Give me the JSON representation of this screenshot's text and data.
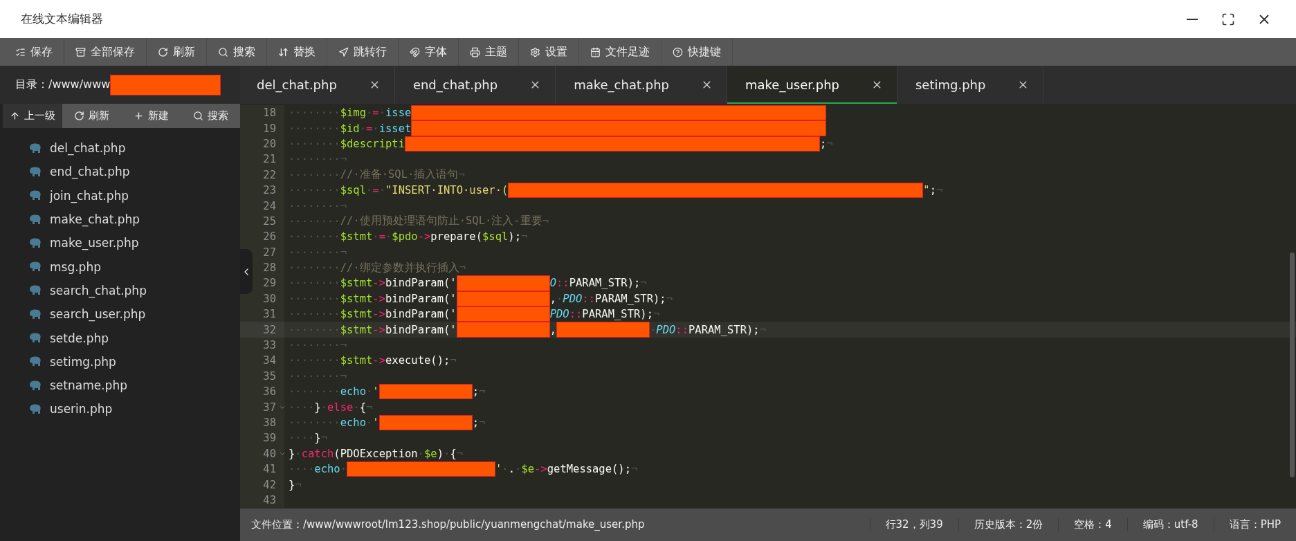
{
  "window": {
    "title": "在线文本编辑器"
  },
  "toolbar": [
    {
      "label": "保存"
    },
    {
      "label": "全部保存"
    },
    {
      "label": "刷新"
    },
    {
      "label": "搜索"
    },
    {
      "label": "替换"
    },
    {
      "label": "跳转行"
    },
    {
      "label": "字体"
    },
    {
      "label": "主题"
    },
    {
      "label": "设置"
    },
    {
      "label": "文件足迹"
    },
    {
      "label": "快捷键"
    }
  ],
  "sidebar": {
    "path_label": "目录：/www/www",
    "path_redacted": true,
    "buttons": [
      {
        "label": "上一级",
        "selected": true
      },
      {
        "label": "刷新",
        "selected": false
      },
      {
        "label": "新建",
        "selected": false
      },
      {
        "label": "搜索",
        "selected": false
      }
    ],
    "files": [
      "del_chat.php",
      "end_chat.php",
      "join_chat.php",
      "make_chat.php",
      "make_user.php",
      "msg.php",
      "search_chat.php",
      "search_user.php",
      "setde.php",
      "setimg.php",
      "setname.php",
      "userin.php"
    ]
  },
  "tabs": [
    {
      "label": "del_chat.php",
      "selected": false
    },
    {
      "label": "end_chat.php",
      "selected": false
    },
    {
      "label": "make_chat.php",
      "selected": false
    },
    {
      "label": "make_user.php",
      "selected": true
    },
    {
      "label": "setimg.php",
      "selected": false
    }
  ],
  "editor": {
    "lines": [
      {
        "number": "18",
        "current": false,
        "fold": false,
        "tokens": [
          {
            "kind": "ws",
            "text": "········"
          },
          {
            "kind": "var",
            "text": "$img"
          },
          {
            "kind": "ws",
            "text": "·"
          },
          {
            "kind": "op",
            "text": "="
          },
          {
            "kind": "ws",
            "text": "·"
          },
          {
            "kind": "func",
            "text": "isse"
          },
          {
            "kind": "redacted_long"
          }
        ]
      },
      {
        "number": "19",
        "current": false,
        "fold": false,
        "tokens": [
          {
            "kind": "ws",
            "text": "········"
          },
          {
            "kind": "var",
            "text": "$id"
          },
          {
            "kind": "ws",
            "text": "·"
          },
          {
            "kind": "op",
            "text": "="
          },
          {
            "kind": "ws",
            "text": "·"
          },
          {
            "kind": "func",
            "text": "isset"
          },
          {
            "kind": "redacted_long"
          }
        ]
      },
      {
        "number": "20",
        "current": false,
        "fold": false,
        "tokens": [
          {
            "kind": "ws",
            "text": "········"
          },
          {
            "kind": "var",
            "text": "$descripti"
          },
          {
            "kind": "redacted_long"
          },
          {
            "kind": "plain",
            "text": ";"
          },
          {
            "kind": "ws",
            "text": "¬"
          }
        ]
      },
      {
        "number": "21",
        "current": false,
        "fold": false,
        "tokens": [
          {
            "kind": "ws",
            "text": "········¬"
          }
        ]
      },
      {
        "number": "22",
        "current": false,
        "fold": false,
        "tokens": [
          {
            "kind": "ws",
            "text": "········"
          },
          {
            "kind": "comment",
            "text": "//·准备·SQL·插入语句"
          },
          {
            "kind": "ws",
            "text": "¬"
          }
        ]
      },
      {
        "number": "23",
        "current": false,
        "fold": false,
        "tokens": [
          {
            "kind": "ws",
            "text": "········"
          },
          {
            "kind": "var",
            "text": "$sql"
          },
          {
            "kind": "ws",
            "text": "·"
          },
          {
            "kind": "op",
            "text": "="
          },
          {
            "kind": "ws",
            "text": "·"
          },
          {
            "kind": "str",
            "text": "\"INSERT·INTO·user·("
          },
          {
            "kind": "redacted_long"
          },
          {
            "kind": "str",
            "text": "\""
          },
          {
            "kind": "plain",
            "text": ";"
          },
          {
            "kind": "ws",
            "text": "¬"
          }
        ]
      },
      {
        "number": "24",
        "current": false,
        "fold": false,
        "tokens": [
          {
            "kind": "ws",
            "text": "········¬"
          }
        ]
      },
      {
        "number": "25",
        "current": false,
        "fold": false,
        "tokens": [
          {
            "kind": "ws",
            "text": "········"
          },
          {
            "kind": "comment",
            "text": "//·使用预处理语句防止·SQL·注入-重要"
          },
          {
            "kind": "ws",
            "text": "¬"
          }
        ]
      },
      {
        "number": "26",
        "current": false,
        "fold": false,
        "tokens": [
          {
            "kind": "ws",
            "text": "········"
          },
          {
            "kind": "var",
            "text": "$stmt"
          },
          {
            "kind": "ws",
            "text": "·"
          },
          {
            "kind": "op",
            "text": "="
          },
          {
            "kind": "ws",
            "text": "·"
          },
          {
            "kind": "var",
            "text": "$pdo"
          },
          {
            "kind": "op",
            "text": "->"
          },
          {
            "kind": "plain",
            "text": "prepare("
          },
          {
            "kind": "var",
            "text": "$sql"
          },
          {
            "kind": "plain",
            "text": ");"
          },
          {
            "kind": "ws",
            "text": "¬"
          }
        ]
      },
      {
        "number": "27",
        "current": false,
        "fold": false,
        "tokens": [
          {
            "kind": "ws",
            "text": "········¬"
          }
        ]
      },
      {
        "number": "28",
        "current": false,
        "fold": false,
        "tokens": [
          {
            "kind": "ws",
            "text": "········"
          },
          {
            "kind": "comment",
            "text": "//·绑定参数并执行插入"
          },
          {
            "kind": "ws",
            "text": "¬"
          }
        ]
      },
      {
        "number": "29",
        "current": false,
        "fold": false,
        "tokens": [
          {
            "kind": "ws",
            "text": "········"
          },
          {
            "kind": "var",
            "text": "$stmt"
          },
          {
            "kind": "op",
            "text": "->"
          },
          {
            "kind": "plain",
            "text": "bindParam('"
          },
          {
            "kind": "redacted"
          },
          {
            "kind": "const",
            "text": "O"
          },
          {
            "kind": "op",
            "text": "::"
          },
          {
            "kind": "plain",
            "text": "PARAM_STR);"
          },
          {
            "kind": "ws",
            "text": "¬"
          }
        ]
      },
      {
        "number": "30",
        "current": false,
        "fold": false,
        "tokens": [
          {
            "kind": "ws",
            "text": "········"
          },
          {
            "kind": "var",
            "text": "$stmt"
          },
          {
            "kind": "op",
            "text": "->"
          },
          {
            "kind": "plain",
            "text": "bindParam('"
          },
          {
            "kind": "redacted"
          },
          {
            "kind": "plain",
            "text": ","
          },
          {
            "kind": "ws",
            "text": "·"
          },
          {
            "kind": "const",
            "text": "PDO"
          },
          {
            "kind": "op",
            "text": "::"
          },
          {
            "kind": "plain",
            "text": "PARAM_STR);"
          },
          {
            "kind": "ws",
            "text": "¬"
          }
        ]
      },
      {
        "number": "31",
        "current": false,
        "fold": false,
        "tokens": [
          {
            "kind": "ws",
            "text": "········"
          },
          {
            "kind": "var",
            "text": "$stmt"
          },
          {
            "kind": "op",
            "text": "->"
          },
          {
            "kind": "plain",
            "text": "bindParam('"
          },
          {
            "kind": "redacted"
          },
          {
            "kind": "const",
            "text": "PDO"
          },
          {
            "kind": "op",
            "text": "::"
          },
          {
            "kind": "plain",
            "text": "PARAM_STR);"
          },
          {
            "kind": "ws",
            "text": "¬"
          }
        ]
      },
      {
        "number": "32",
        "current": true,
        "fold": false,
        "tokens": [
          {
            "kind": "ws",
            "text": "········"
          },
          {
            "kind": "var",
            "text": "$stmt"
          },
          {
            "kind": "op",
            "text": "->"
          },
          {
            "kind": "plain",
            "text": "bindParam('"
          },
          {
            "kind": "redacted"
          },
          {
            "kind": "plain",
            "text": ","
          },
          {
            "kind": "redacted"
          },
          {
            "kind": "ws",
            "text": "·"
          },
          {
            "kind": "const",
            "text": "PDO"
          },
          {
            "kind": "op",
            "text": "::"
          },
          {
            "kind": "plain",
            "text": "PARAM_STR);"
          },
          {
            "kind": "ws",
            "text": "¬"
          }
        ]
      },
      {
        "number": "33",
        "current": false,
        "fold": false,
        "tokens": [
          {
            "kind": "ws",
            "text": "········¬"
          }
        ]
      },
      {
        "number": "34",
        "current": false,
        "fold": false,
        "tokens": [
          {
            "kind": "ws",
            "text": "········"
          },
          {
            "kind": "var",
            "text": "$stmt"
          },
          {
            "kind": "op",
            "text": "->"
          },
          {
            "kind": "plain",
            "text": "execute();"
          },
          {
            "kind": "ws",
            "text": "¬"
          }
        ]
      },
      {
        "number": "35",
        "current": false,
        "fold": false,
        "tokens": [
          {
            "kind": "ws",
            "text": "········¬"
          }
        ]
      },
      {
        "number": "36",
        "current": false,
        "fold": false,
        "tokens": [
          {
            "kind": "ws",
            "text": "········"
          },
          {
            "kind": "func",
            "text": "echo"
          },
          {
            "kind": "ws",
            "text": "·"
          },
          {
            "kind": "str",
            "text": "'"
          },
          {
            "kind": "redacted"
          },
          {
            "kind": "plain",
            "text": ";"
          },
          {
            "kind": "ws",
            "text": "¬"
          }
        ]
      },
      {
        "number": "37",
        "current": false,
        "fold": true,
        "tokens": [
          {
            "kind": "ws",
            "text": "····"
          },
          {
            "kind": "plain",
            "text": "}"
          },
          {
            "kind": "ws",
            "text": "·"
          },
          {
            "kind": "keyword",
            "text": "else"
          },
          {
            "kind": "ws",
            "text": "·"
          },
          {
            "kind": "plain",
            "text": "{"
          },
          {
            "kind": "ws",
            "text": "¬"
          }
        ]
      },
      {
        "number": "38",
        "current": false,
        "fold": false,
        "tokens": [
          {
            "kind": "ws",
            "text": "········"
          },
          {
            "kind": "func",
            "text": "echo"
          },
          {
            "kind": "ws",
            "text": "·"
          },
          {
            "kind": "str",
            "text": "'"
          },
          {
            "kind": "redacted"
          },
          {
            "kind": "plain",
            "text": ";"
          },
          {
            "kind": "ws",
            "text": "¬"
          }
        ]
      },
      {
        "number": "39",
        "current": false,
        "fold": false,
        "tokens": [
          {
            "kind": "ws",
            "text": "····"
          },
          {
            "kind": "plain",
            "text": "}"
          },
          {
            "kind": "ws",
            "text": "¬"
          }
        ]
      },
      {
        "number": "40",
        "current": false,
        "fold": true,
        "tokens": [
          {
            "kind": "plain",
            "text": "}"
          },
          {
            "kind": "ws",
            "text": "·"
          },
          {
            "kind": "keyword",
            "text": "catch"
          },
          {
            "kind": "plain",
            "text": "(PDOException"
          },
          {
            "kind": "ws",
            "text": "·"
          },
          {
            "kind": "var",
            "text": "$e"
          },
          {
            "kind": "plain",
            "text": ")"
          },
          {
            "kind": "ws",
            "text": "·"
          },
          {
            "kind": "plain",
            "text": "{"
          },
          {
            "kind": "ws",
            "text": "¬"
          }
        ]
      },
      {
        "number": "41",
        "current": false,
        "fold": false,
        "tokens": [
          {
            "kind": "ws",
            "text": "····"
          },
          {
            "kind": "func",
            "text": "echo"
          },
          {
            "kind": "ws",
            "text": "·"
          },
          {
            "kind": "redacted_mid"
          },
          {
            "kind": "str",
            "text": "'"
          },
          {
            "kind": "ws",
            "text": "·"
          },
          {
            "kind": "plain",
            "text": "."
          },
          {
            "kind": "ws",
            "text": "·"
          },
          {
            "kind": "var",
            "text": "$e"
          },
          {
            "kind": "op",
            "text": "->"
          },
          {
            "kind": "plain",
            "text": "getMessage();"
          },
          {
            "kind": "ws",
            "text": "¬"
          }
        ]
      },
      {
        "number": "42",
        "current": false,
        "fold": false,
        "tokens": [
          {
            "kind": "plain",
            "text": "}"
          },
          {
            "kind": "ws",
            "text": "¬"
          }
        ]
      },
      {
        "number": "43",
        "current": false,
        "fold": false
      }
    ]
  },
  "status_bar": {
    "file_location": "文件位置：/www/wwwroot/lm123.shop/public/yuanmengchat/make_user.php",
    "items": [
      "行32，列39",
      "历史版本：2份",
      "空格：4",
      "编码：utf-8",
      "语言：PHP"
    ]
  }
}
